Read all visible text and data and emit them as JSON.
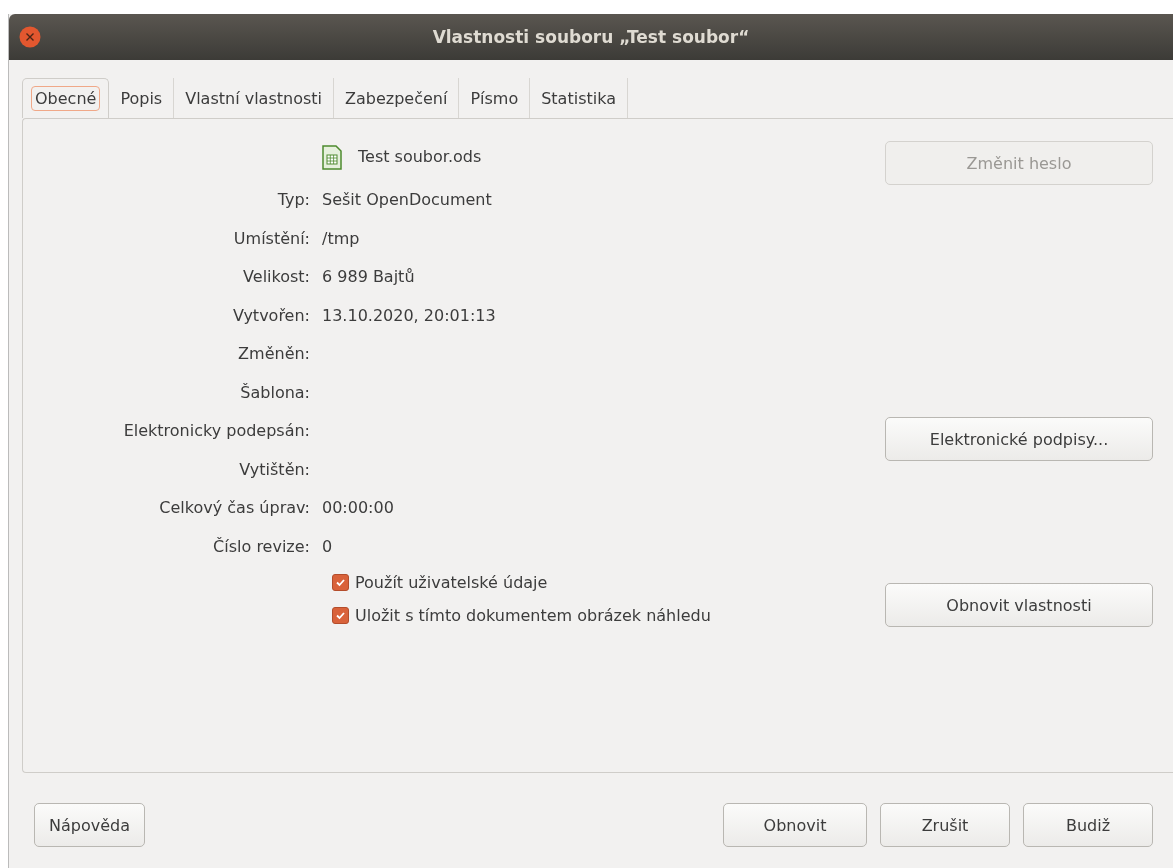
{
  "window": {
    "title": "Vlastnosti souboru „Test soubor“"
  },
  "tabs": [
    {
      "label": "Obecné",
      "selected": true
    },
    {
      "label": "Popis",
      "selected": false
    },
    {
      "label": "Vlastní vlastnosti",
      "selected": false
    },
    {
      "label": "Zabezpečení",
      "selected": false
    },
    {
      "label": "Písmo",
      "selected": false
    },
    {
      "label": "Statistika",
      "selected": false
    }
  ],
  "file_name": "Test soubor.ods",
  "properties": [
    {
      "label": "Typ:",
      "value": "Sešit OpenDocument"
    },
    {
      "label": "Umístění:",
      "value": "/tmp"
    },
    {
      "label": "Velikost:",
      "value": "6 989 Bajtů"
    },
    {
      "label": "Vytvořen:",
      "value": "13.10.2020, 20:01:13"
    },
    {
      "label": "Změněn:"
    },
    {
      "label": "Šablona:"
    },
    {
      "label": "Elektronicky podepsán:"
    },
    {
      "label": "Vytištěn:"
    },
    {
      "label": "Celkový čas úprav:",
      "value": "00:00:00"
    },
    {
      "label": "Číslo revize:",
      "value": "0"
    }
  ],
  "checkboxes": [
    {
      "label": "Použít uživatelské údaje",
      "checked": true
    },
    {
      "label": "Uložit s tímto dokumentem obrázek náhledu",
      "checked": true
    }
  ],
  "side_buttons": [
    {
      "label": "Změnit heslo",
      "disabled": true
    },
    {
      "label": "Elektronické podpisy...",
      "disabled": false
    },
    {
      "label": "Obnovit vlastnosti",
      "disabled": false
    }
  ],
  "help_button": "Nápověda",
  "footer_buttons": [
    "Obnovit",
    "Zrušit",
    "Budiž"
  ]
}
